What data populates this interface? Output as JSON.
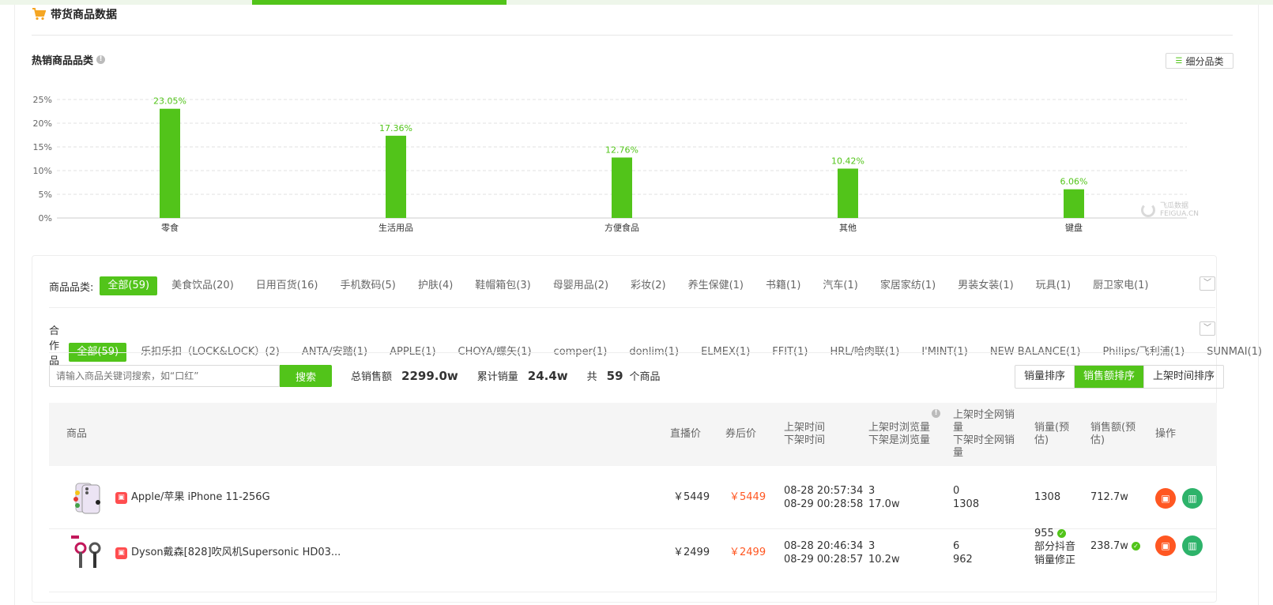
{
  "header": {
    "title": "带货商品数据"
  },
  "category_section": {
    "title": "热销商品品类",
    "info": "!",
    "sub_button": "细分品类"
  },
  "chart_data": {
    "type": "bar",
    "categories": [
      "零食",
      "生活用品",
      "方便食品",
      "其他",
      "键盘"
    ],
    "values": [
      23.05,
      17.36,
      12.76,
      10.42,
      6.06
    ],
    "labels": [
      "23.05%",
      "17.36%",
      "12.76%",
      "10.42%",
      "6.06%"
    ],
    "ylim": [
      0,
      25
    ],
    "yticks": [
      "0%",
      "5%",
      "10%",
      "15%",
      "20%",
      "25%"
    ],
    "grid": true,
    "color": "#52c41a"
  },
  "watermark": {
    "line1": "飞瓜数据",
    "line2": "FEIGUA.CN"
  },
  "filters": {
    "category_label": "商品品类:",
    "categories": [
      "全部(59)",
      "美食饮品(20)",
      "日用百货(16)",
      "手机数码(5)",
      "护肤(4)",
      "鞋帽箱包(3)",
      "母婴用品(2)",
      "彩妆(2)",
      "养生保健(1)",
      "书籍(1)",
      "汽车(1)",
      "家居家纺(1)",
      "男装女装(1)",
      "玩具(1)",
      "厨卫家电(1)"
    ],
    "brand_label": "合作品牌:",
    "brands": [
      "全部(59)",
      "乐扣乐扣（LOCK&LOCK）(2)",
      "ANTA/安踏(1)",
      "APPLE(1)",
      "CHOYA/蝶矢(1)",
      "comper(1)",
      "donlim(1)",
      "ELMEX(1)",
      "FFIT(1)",
      "HRL/哈肉联(1)",
      "I'MINT(1)",
      "NEW BALANCE(1)",
      "Philips/飞利浦(1)",
      "SUNMAI(1)"
    ],
    "expand": "﹀"
  },
  "search": {
    "placeholder": "请输入商品关键词搜索，如“口红”",
    "button": "搜索"
  },
  "stats": {
    "sales_label": "总销售额",
    "sales_value": "2299.0w",
    "volume_label": "累计销量",
    "volume_value": "24.4w",
    "count_prefix": "共",
    "count_value": "59",
    "count_suffix": "个商品"
  },
  "sort": [
    "销量排序",
    "销售额排序",
    "上架时间排序"
  ],
  "table": {
    "headers": {
      "product": "商品",
      "live_price": "直播价",
      "coupon_price": "券后价",
      "time1": "上架时间",
      "time2": "下架时间",
      "views1": "上架时浏览量",
      "views2": "下架是浏览量",
      "net1": "上架时全网销",
      "net1b": "量",
      "net2": "下架时全网销",
      "net2b": "量",
      "vol1": "销量(预",
      "vol2": "估)",
      "amt1": "销售额(预",
      "amt2": "估)",
      "op": "操作"
    },
    "rows": [
      {
        "name": "Apple/苹果 iPhone 11-256G",
        "live_price": "￥5449",
        "coupon_price": "￥5449",
        "on_time": "08-28 20:57:34",
        "off_time": "08-29 00:28:58",
        "views_on": "3",
        "views_off": "17.0w",
        "net_on": "0",
        "net_off": "1308",
        "volume": "1308",
        "amount": "712.7w"
      },
      {
        "name": "Dyson戴森[828]吹风机Supersonic HD03...",
        "live_price": "￥2499",
        "coupon_price": "￥2499",
        "on_time": "08-28 20:46:34",
        "off_time": "08-29 00:28:57",
        "views_on": "3",
        "views_off": "10.2w",
        "net_on": "6",
        "net_off": "962",
        "volume": "955",
        "volume_note1": "部分抖音",
        "volume_note2": "销量修正",
        "amount": "238.7w"
      }
    ]
  }
}
